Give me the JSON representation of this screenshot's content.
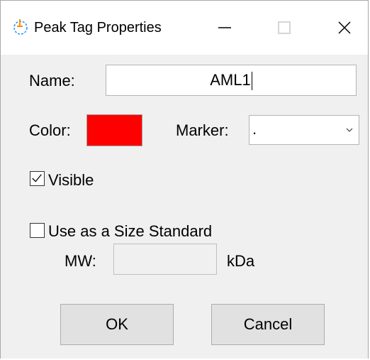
{
  "window": {
    "title": "Peak Tag Properties",
    "icon": "peak-tag-icon",
    "controls": {
      "minimize": "minimize-icon",
      "maximize": "maximize-icon",
      "close": "close-icon"
    }
  },
  "form": {
    "name_label": "Name:",
    "name_value": "AML1",
    "color_label": "Color:",
    "color_value": "#ff0000",
    "marker_label": "Marker:",
    "marker_value": ".",
    "visible_label": "Visible",
    "visible_checked": true,
    "size_standard_label": "Use as a Size Standard",
    "size_standard_checked": false,
    "mw_label": "MW:",
    "mw_value": "",
    "mw_unit": "kDa"
  },
  "buttons": {
    "ok": "OK",
    "cancel": "Cancel"
  }
}
